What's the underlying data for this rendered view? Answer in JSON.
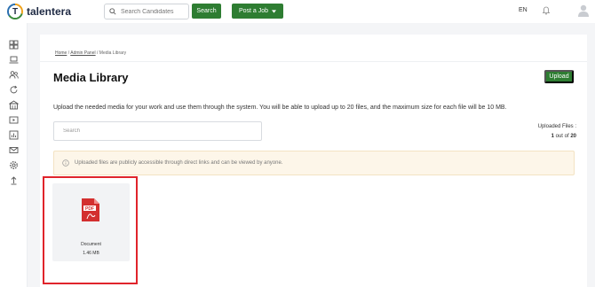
{
  "brand": {
    "name": "talentera"
  },
  "header": {
    "search_placeholder": "Search Candidates",
    "search_button": "Search",
    "post_job_button": "Post a Job",
    "language": "EN"
  },
  "sidebar": {
    "items": [
      {
        "icon": "dashboard-icon"
      },
      {
        "icon": "laptop-icon"
      },
      {
        "icon": "users-icon"
      },
      {
        "icon": "refresh-icon"
      },
      {
        "icon": "building-icon"
      },
      {
        "icon": "video-icon"
      },
      {
        "icon": "analytics-icon"
      },
      {
        "icon": "mail-icon"
      },
      {
        "icon": "settings-icon"
      },
      {
        "icon": "upload-icon"
      }
    ]
  },
  "breadcrumb": {
    "home": "Home",
    "admin_panel": "Admin Panel",
    "current": "Media Library",
    "separator": " / "
  },
  "page": {
    "title": "Media Library",
    "upload_button": "Upload",
    "description": "Upload the needed media for your work and use them through the system. You will be able to upload up to 20 files, and the maximum size for each file will be 10 MB.",
    "search_placeholder": "Search",
    "uploaded_label": "Uploaded Files :",
    "uploaded_count": "1",
    "uploaded_of": " out of ",
    "uploaded_max": "20",
    "notice": "Uploaded files are publicly accessible through direct links and can be viewed by anyone."
  },
  "files": [
    {
      "name": "Document",
      "size": "1.46 MB",
      "type_label": "PDF"
    }
  ],
  "colors": {
    "primary": "#2e7d32",
    "notice_bg": "#fdf6e9",
    "highlight": "#e0242b",
    "pdf_red": "#d32f2f"
  }
}
